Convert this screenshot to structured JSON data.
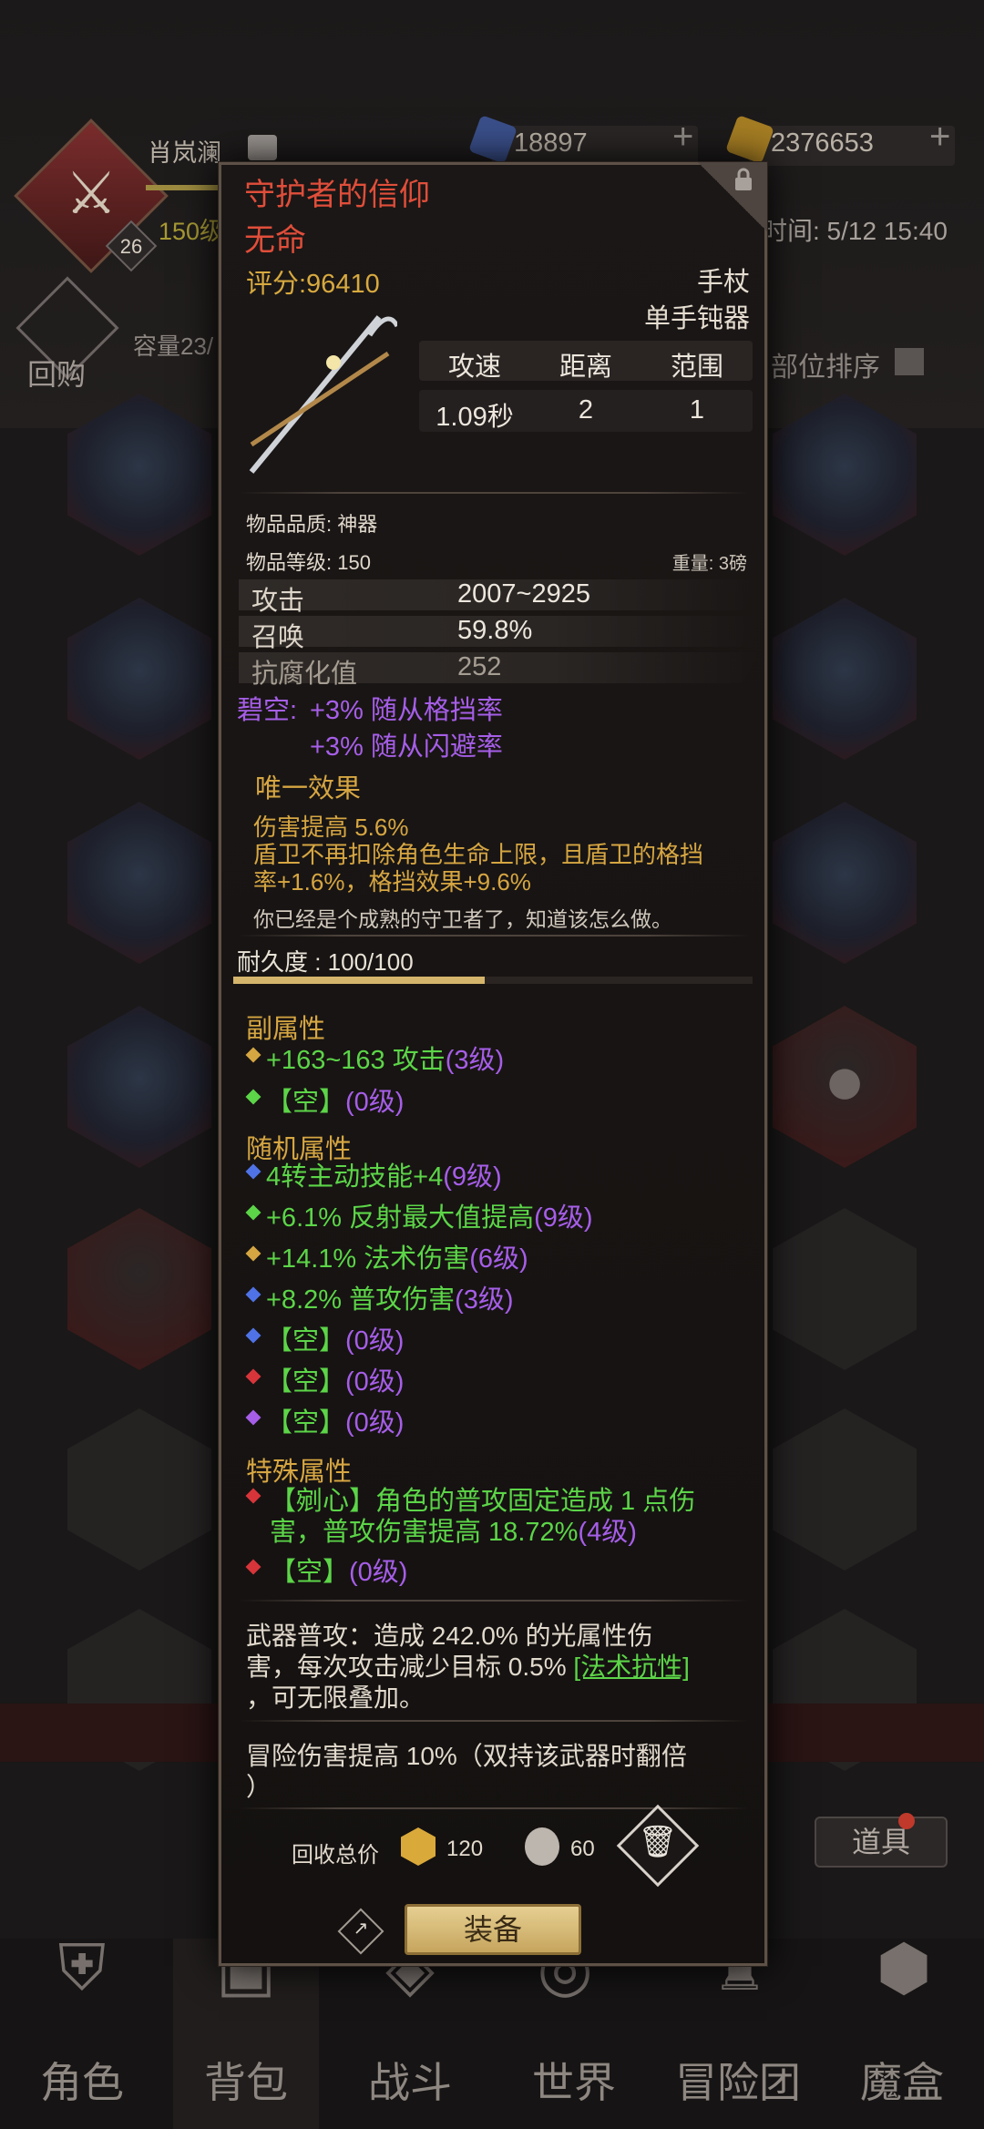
{
  "header": {
    "player_name": "肖岚澜",
    "player_level": "150级",
    "avatar_level": "26",
    "currency_blue": "18897",
    "currency_gold": "2376653",
    "time_label": "时间: 5/12 15:40"
  },
  "toolbar": {
    "buyback_label": "回购",
    "capacity_label": "容量23/",
    "sort_label": "部位排序"
  },
  "item": {
    "name": "守护者的信仰",
    "subtitle": "无命",
    "score": "评分:96410",
    "type_primary": "手杖",
    "type_secondary": "单手钝器",
    "stats_headers": [
      "攻速",
      "距离",
      "范围"
    ],
    "stats_values": [
      "1.09秒",
      "2",
      "1"
    ],
    "quality": "物品品质: 神器",
    "level": "物品等级: 150",
    "weight": "重量: 3磅",
    "attributes": [
      {
        "name": "攻击",
        "value": "2007~2925"
      },
      {
        "name": "召唤",
        "value": "59.8%"
      },
      {
        "name": "抗腐化值",
        "value": "252"
      }
    ],
    "set_name": "碧空:",
    "set_effects": [
      "+3% 随从格挡率",
      "+3% 随从闪避率"
    ],
    "unique_title": "唯一效果",
    "unique_effects": [
      "伤害提高 5.6%",
      "盾卫不再扣除角色生命上限，且盾卫的格挡",
      "率+1.6%，格挡效果+9.6%"
    ],
    "flavor": "你已经是个成熟的守卫者了，知道该怎么做。",
    "durability": "耐久度 : 100/100",
    "durability_fraction": 1.0,
    "secondary_title": "副属性",
    "secondary": [
      {
        "bullet": "gold",
        "text": "+163~163 攻击",
        "lvl": "(3级)"
      },
      {
        "bullet": "green",
        "text": "【空】",
        "lvl": "(0级)"
      }
    ],
    "random_title": "随机属性",
    "random": [
      {
        "bullet": "blue",
        "text": "4转主动技能+4",
        "lvl": "(9级)"
      },
      {
        "bullet": "green",
        "text": "+6.1% 反射最大值提高",
        "lvl": "(9级)"
      },
      {
        "bullet": "gold",
        "text": "+14.1% 法术伤害",
        "lvl": "(6级)"
      },
      {
        "bullet": "blue",
        "text": "+8.2% 普攻伤害",
        "lvl": "(3级)"
      },
      {
        "bullet": "blue",
        "text": "【空】",
        "lvl": "(0级)"
      },
      {
        "bullet": "red",
        "text": "【空】",
        "lvl": "(0级)"
      },
      {
        "bullet": "purple",
        "text": "【空】",
        "lvl": "(0级)"
      }
    ],
    "special_title": "特殊属性",
    "special_line1": "【剜心】角色的普攻固定造成 1 点伤",
    "special_line2": "害，普攻伤害提高 18.72%",
    "special_line2_lvl": "(4级)",
    "special_empty": "【空】",
    "special_empty_lvl": "(0级)",
    "weapon_attack_1": "武器普攻：造成 242.0% 的光属性伤",
    "weapon_attack_2": "害，每次攻击减少目标 0.5% ",
    "weapon_attack_link": "[法术抗性]",
    "weapon_attack_3": "，可无限叠加。",
    "adventure_1": "冒险伤害提高 10%（双持该武器时翻倍",
    "adventure_2": "）",
    "recycle_label": "回收总价",
    "recycle_coin": "120",
    "recycle_dust": "60",
    "equip_label": "装备"
  },
  "side": {
    "daoju_label": "道具"
  },
  "nav": [
    "角色",
    "背包",
    "战斗",
    "世界",
    "冒险团",
    "魔盒"
  ],
  "colors": {
    "item_name": "#e04e3a",
    "score": "#d7a93f",
    "purple": "#a65ee8",
    "green": "#5cd548",
    "gold": "#d6a642"
  }
}
